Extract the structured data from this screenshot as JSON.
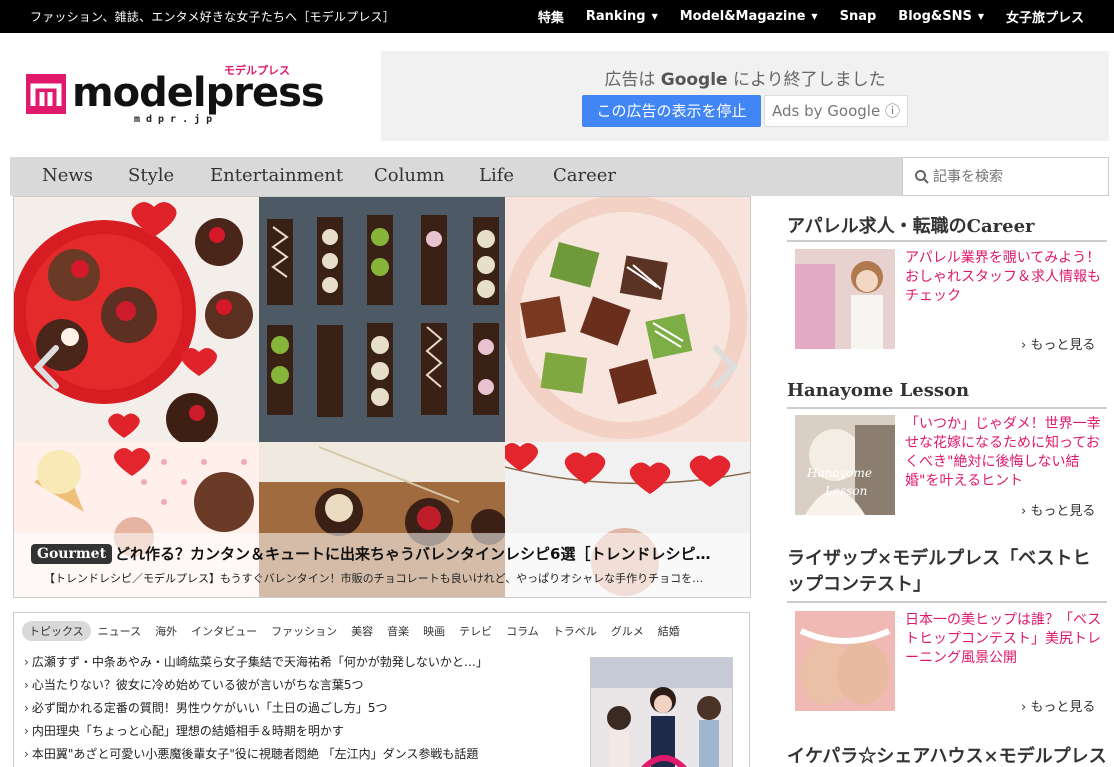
{
  "topbar": {
    "tagline": "ファッション、雑誌、エンタメ好きな女子たちへ［モデルプレス］",
    "nav": [
      {
        "label": "特集",
        "dropdown": false
      },
      {
        "label": "Ranking",
        "dropdown": true
      },
      {
        "label": "Model&Magazine",
        "dropdown": true
      },
      {
        "label": "Snap",
        "dropdown": false
      },
      {
        "label": "Blog&SNS",
        "dropdown": true
      },
      {
        "label": "女子旅プレス",
        "dropdown": false
      }
    ]
  },
  "logo": {
    "word": "modelpress",
    "sub": "モデルプレス",
    "domain": "mdpr.jp",
    "brand_color": "#e0196d"
  },
  "ad": {
    "title_pre": "広告は",
    "title_brand": "Google",
    "title_post": "により終了しました",
    "stop_label": "この広告の表示を停止",
    "adsby_label": "Ads by Google ⓘ"
  },
  "mainnav": {
    "items": [
      "News",
      "Style",
      "Entertainment",
      "Column",
      "Life",
      "Career"
    ],
    "search_placeholder": "記事を検索"
  },
  "hero": {
    "category": "Gourmet",
    "title": "どれ作る？カンタン＆キュートに出来ちゃうバレンタインレシピ6選［トレンドレシピ…",
    "description": "【トレンドレシピ／モデルプレス】もうすぐバレンタイン！市販のチョコレートも良いけれど、やっぱりオシャレな手作りチョコを…"
  },
  "topics": {
    "tabs": [
      "トピックス",
      "ニュース",
      "海外",
      "インタビュー",
      "ファッション",
      "美容",
      "音楽",
      "映画",
      "テレビ",
      "コラム",
      "トラベル",
      "グルメ",
      "結婚"
    ],
    "items": [
      "広瀬すず・中条あやみ・山崎紘菜ら女子集結で天海祐希「何かが勃発しないかと…」",
      "心当たりない？彼女に冷め始めている彼が言いがちな言葉5つ",
      "必ず聞かれる定番の質問！男性ウケがいい「土日の過ごし方」5つ",
      "内田理央「ちょっと心配」理想の結婚相手＆時期を明かす",
      "本田翼\"あざと可愛い小悪魔後輩女子\"役に視聴者悶絶 「左江内」ダンス参戦も話題"
    ]
  },
  "sidebar": {
    "sections": [
      {
        "title": "アパレル求人・転職のCareer",
        "text": "アパレル業界を覗いてみよう！おしゃれスタッフ＆求人情報もチェック",
        "more": "もっと見る"
      },
      {
        "title": "Hanayome Lesson",
        "text": "「いつか」じゃダメ！世界一幸せな花嫁になるために知っておくべき\"絶対に後悔しない結婚\"を叶えるヒント",
        "more": "もっと見る"
      },
      {
        "title": "ライザップ×モデルプレス「ベストヒップコンテスト」",
        "text": "日本一の美ヒップは誰？「ベストヒップコンテスト」美尻トレーニング風景公開",
        "more": "もっと見る"
      },
      {
        "title": "イケパラ☆シェアハウス×モデルプレス",
        "text": "",
        "more": ""
      }
    ]
  }
}
